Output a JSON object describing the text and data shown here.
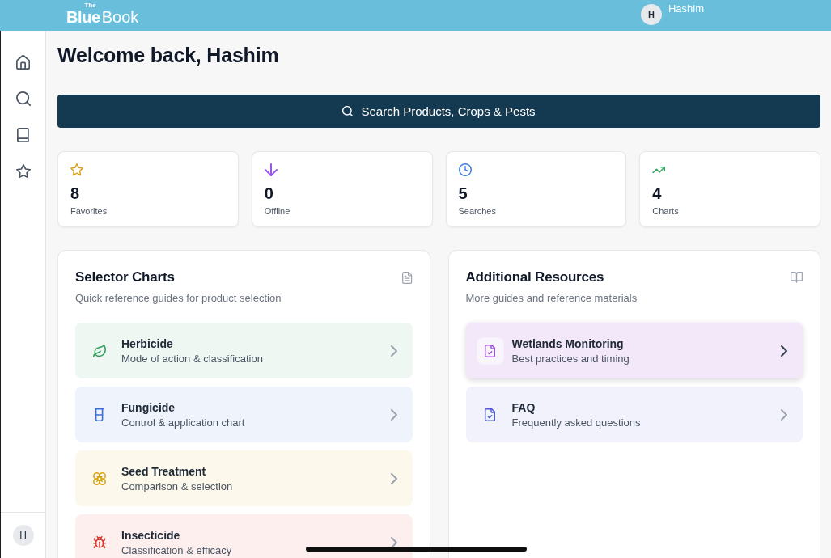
{
  "topbar": {
    "logo": {
      "small": "The",
      "bold": "Blue",
      "regular": "Book"
    },
    "user": {
      "initial": "H",
      "name": "Hashim"
    }
  },
  "sidebar": {
    "user": {
      "initial": "H"
    }
  },
  "heading": "Welcome back, Hashim",
  "search": {
    "label": "Search Products, Crops & Pests"
  },
  "stats": [
    {
      "value": "8",
      "label": "Favorites",
      "color": "#d9a21b"
    },
    {
      "value": "0",
      "label": "Offline",
      "color": "#9b59e6"
    },
    {
      "value": "5",
      "label": "Searches",
      "color": "#3b7de8"
    },
    {
      "value": "4",
      "label": "Charts",
      "color": "#2ea55c"
    }
  ],
  "panels": [
    {
      "title": "Selector Charts",
      "subtitle": "Quick reference guides for product selection",
      "items": [
        {
          "title": "Herbicide",
          "subtitle": "Mode of action & classification",
          "color": "#2f9e5a",
          "selected": false
        },
        {
          "title": "Fungicide",
          "subtitle": "Control & application chart",
          "color": "#3b6fd8",
          "selected": false
        },
        {
          "title": "Seed Treatment",
          "subtitle": "Comparison & selection",
          "color": "#d9a514",
          "selected": false
        },
        {
          "title": "Insecticide",
          "subtitle": "Classification & efficacy",
          "color": "#d7372b",
          "selected": false
        }
      ]
    },
    {
      "title": "Additional Resources",
      "subtitle": "More guides and reference materials",
      "items": [
        {
          "title": "Wetlands Monitoring",
          "subtitle": "Best practices and timing",
          "color": "#9a4fd6",
          "selected": true
        },
        {
          "title": "FAQ",
          "subtitle": "Frequently asked questions",
          "color": "#4d5bd6",
          "selected": false
        }
      ]
    }
  ]
}
